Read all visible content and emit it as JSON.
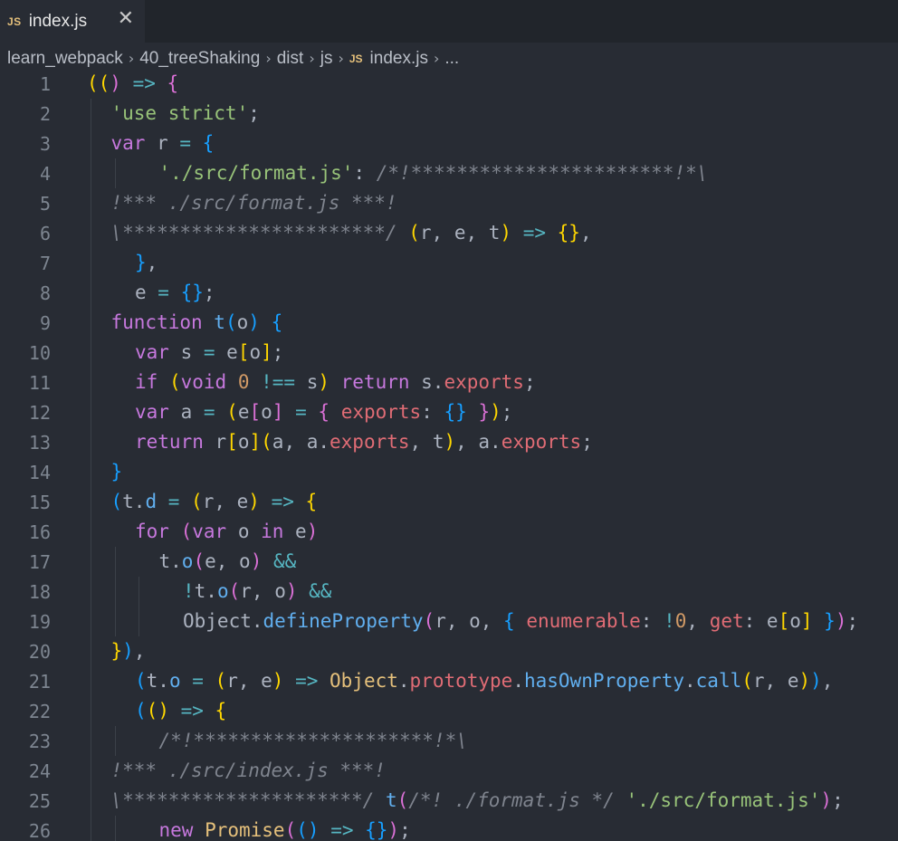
{
  "tab": {
    "badge": "JS",
    "label": "index.js",
    "close": "✕"
  },
  "breadcrumb": {
    "items": [
      "learn_webpack",
      "40_treeShaking",
      "dist",
      "js"
    ],
    "file_badge": "JS",
    "file": "index.js",
    "ellipsis": "..."
  },
  "editor": {
    "lines": [
      {
        "n": "1",
        "indent": 0,
        "guides": 0,
        "toks": [
          [
            "b1",
            "(("
          ],
          [
            "b2",
            ")"
          ],
          [
            "op",
            " => "
          ],
          [
            "b2",
            "{"
          ]
        ]
      },
      {
        "n": "2",
        "indent": 1,
        "guides": 1,
        "toks": [
          [
            "str",
            "'use strict'"
          ],
          [
            "tx",
            ";"
          ]
        ]
      },
      {
        "n": "3",
        "indent": 1,
        "guides": 1,
        "toks": [
          [
            "kw",
            "var "
          ],
          [
            "tx",
            "r "
          ],
          [
            "op",
            "= "
          ],
          [
            "b3",
            "{"
          ]
        ]
      },
      {
        "n": "4",
        "indent": 3,
        "guides": 2,
        "toks": [
          [
            "str",
            "'./src/format.js'"
          ],
          [
            "tx",
            ": "
          ],
          [
            "cm",
            "/*!***********************!*\\"
          ]
        ]
      },
      {
        "n": "5",
        "indent": 1,
        "guides": 1,
        "toks": [
          [
            "cm",
            "!*** ./src/format.js ***!"
          ]
        ]
      },
      {
        "n": "6",
        "indent": 1,
        "guides": 1,
        "toks": [
          [
            "cm",
            "\\***********************/ "
          ],
          [
            "b1",
            "("
          ],
          [
            "tx",
            "r, e, t"
          ],
          [
            "b1",
            ")"
          ],
          [
            "op",
            " => "
          ],
          [
            "b1",
            "{}"
          ],
          [
            "tx",
            ","
          ]
        ]
      },
      {
        "n": "7",
        "indent": 2,
        "guides": 1,
        "toks": [
          [
            "b3",
            "}"
          ],
          [
            "tx",
            ","
          ]
        ]
      },
      {
        "n": "8",
        "indent": 2,
        "guides": 1,
        "toks": [
          [
            "tx",
            "e "
          ],
          [
            "op",
            "= "
          ],
          [
            "b3",
            "{}"
          ],
          [
            "tx",
            ";"
          ]
        ]
      },
      {
        "n": "9",
        "indent": 1,
        "guides": 1,
        "toks": [
          [
            "kw",
            "function "
          ],
          [
            "fn",
            "t"
          ],
          [
            "b3",
            "("
          ],
          [
            "tx",
            "o"
          ],
          [
            "b3",
            ")"
          ],
          [
            "tx",
            " "
          ],
          [
            "b3",
            "{"
          ]
        ]
      },
      {
        "n": "10",
        "indent": 2,
        "guides": 1,
        "toks": [
          [
            "kw",
            "var "
          ],
          [
            "tx",
            "s "
          ],
          [
            "op",
            "= "
          ],
          [
            "tx",
            "e"
          ],
          [
            "b1",
            "["
          ],
          [
            "tx",
            "o"
          ],
          [
            "b1",
            "]"
          ],
          [
            "tx",
            ";"
          ]
        ]
      },
      {
        "n": "11",
        "indent": 2,
        "guides": 1,
        "toks": [
          [
            "kw",
            "if "
          ],
          [
            "b1",
            "("
          ],
          [
            "kw",
            "void "
          ],
          [
            "num",
            "0"
          ],
          [
            "op",
            " !== "
          ],
          [
            "tx",
            "s"
          ],
          [
            "b1",
            ")"
          ],
          [
            "kw",
            " return "
          ],
          [
            "tx",
            "s."
          ],
          [
            "prop",
            "exports"
          ],
          [
            "tx",
            ";"
          ]
        ]
      },
      {
        "n": "12",
        "indent": 2,
        "guides": 1,
        "toks": [
          [
            "kw",
            "var "
          ],
          [
            "tx",
            "a "
          ],
          [
            "op",
            "= "
          ],
          [
            "b1",
            "("
          ],
          [
            "tx",
            "e"
          ],
          [
            "b2",
            "["
          ],
          [
            "tx",
            "o"
          ],
          [
            "b2",
            "]"
          ],
          [
            "op",
            " = "
          ],
          [
            "b2",
            "{ "
          ],
          [
            "prop",
            "exports"
          ],
          [
            "tx",
            ": "
          ],
          [
            "b3",
            "{}"
          ],
          [
            "b2",
            " }"
          ],
          [
            "b1",
            ")"
          ],
          [
            "tx",
            ";"
          ]
        ]
      },
      {
        "n": "13",
        "indent": 2,
        "guides": 1,
        "toks": [
          [
            "kw",
            "return "
          ],
          [
            "tx",
            "r"
          ],
          [
            "b1",
            "["
          ],
          [
            "tx",
            "o"
          ],
          [
            "b1",
            "]"
          ],
          [
            "b1",
            "("
          ],
          [
            "tx",
            "a, a."
          ],
          [
            "prop",
            "exports"
          ],
          [
            "tx",
            ", t"
          ],
          [
            "b1",
            ")"
          ],
          [
            "tx",
            ", a."
          ],
          [
            "prop",
            "exports"
          ],
          [
            "tx",
            ";"
          ]
        ]
      },
      {
        "n": "14",
        "indent": 1,
        "guides": 1,
        "toks": [
          [
            "b3",
            "}"
          ]
        ]
      },
      {
        "n": "15",
        "indent": 1,
        "guides": 1,
        "toks": [
          [
            "b3",
            "("
          ],
          [
            "tx",
            "t."
          ],
          [
            "fn",
            "d"
          ],
          [
            "op",
            " = "
          ],
          [
            "b1",
            "("
          ],
          [
            "tx",
            "r, e"
          ],
          [
            "b1",
            ")"
          ],
          [
            "op",
            " => "
          ],
          [
            "b1",
            "{"
          ]
        ]
      },
      {
        "n": "16",
        "indent": 2,
        "guides": 1,
        "toks": [
          [
            "kw",
            "for "
          ],
          [
            "b2",
            "("
          ],
          [
            "kw",
            "var "
          ],
          [
            "tx",
            "o "
          ],
          [
            "kw",
            "in "
          ],
          [
            "tx",
            "e"
          ],
          [
            "b2",
            ")"
          ]
        ]
      },
      {
        "n": "17",
        "indent": 3,
        "guides": 2,
        "toks": [
          [
            "tx",
            "t."
          ],
          [
            "fn",
            "o"
          ],
          [
            "b2",
            "("
          ],
          [
            "tx",
            "e, o"
          ],
          [
            "b2",
            ")"
          ],
          [
            "op",
            " &&"
          ]
        ]
      },
      {
        "n": "18",
        "indent": 4,
        "guides": 3,
        "toks": [
          [
            "op",
            "!"
          ],
          [
            "tx",
            "t."
          ],
          [
            "fn",
            "o"
          ],
          [
            "b2",
            "("
          ],
          [
            "tx",
            "r, o"
          ],
          [
            "b2",
            ")"
          ],
          [
            "op",
            " &&"
          ]
        ]
      },
      {
        "n": "19",
        "indent": 4,
        "guides": 3,
        "toks": [
          [
            "tx",
            "Object."
          ],
          [
            "fn",
            "defineProperty"
          ],
          [
            "b2",
            "("
          ],
          [
            "tx",
            "r, o, "
          ],
          [
            "b3",
            "{ "
          ],
          [
            "prop",
            "enumerable"
          ],
          [
            "tx",
            ": "
          ],
          [
            "op",
            "!"
          ],
          [
            "num",
            "0"
          ],
          [
            "tx",
            ", "
          ],
          [
            "prop",
            "get"
          ],
          [
            "tx",
            ": e"
          ],
          [
            "b1",
            "["
          ],
          [
            "tx",
            "o"
          ],
          [
            "b1",
            "]"
          ],
          [
            "b3",
            " }"
          ],
          [
            "b2",
            ")"
          ],
          [
            "tx",
            ";"
          ]
        ]
      },
      {
        "n": "20",
        "indent": 1,
        "guides": 1,
        "toks": [
          [
            "b1",
            "}"
          ],
          [
            "b3",
            ")"
          ],
          [
            "tx",
            ","
          ]
        ]
      },
      {
        "n": "21",
        "indent": 2,
        "guides": 1,
        "toks": [
          [
            "b3",
            "("
          ],
          [
            "tx",
            "t."
          ],
          [
            "fn",
            "o"
          ],
          [
            "op",
            " = "
          ],
          [
            "b1",
            "("
          ],
          [
            "tx",
            "r, e"
          ],
          [
            "b1",
            ")"
          ],
          [
            "op",
            " => "
          ],
          [
            "cls",
            "Object"
          ],
          [
            "tx",
            "."
          ],
          [
            "prop",
            "prototype"
          ],
          [
            "tx",
            "."
          ],
          [
            "fn",
            "hasOwnProperty"
          ],
          [
            "tx",
            "."
          ],
          [
            "fn",
            "call"
          ],
          [
            "b1",
            "("
          ],
          [
            "tx",
            "r, e"
          ],
          [
            "b1",
            ")"
          ],
          [
            "b3",
            ")"
          ],
          [
            "tx",
            ","
          ]
        ]
      },
      {
        "n": "22",
        "indent": 2,
        "guides": 1,
        "toks": [
          [
            "b3",
            "("
          ],
          [
            "b1",
            "("
          ],
          [
            "b1",
            ")"
          ],
          [
            "op",
            " => "
          ],
          [
            "b1",
            "{"
          ]
        ]
      },
      {
        "n": "23",
        "indent": 3,
        "guides": 2,
        "toks": [
          [
            "cm",
            "/*!*********************!*\\"
          ]
        ]
      },
      {
        "n": "24",
        "indent": 1,
        "guides": 1,
        "toks": [
          [
            "cm",
            "!*** ./src/index.js ***!"
          ]
        ]
      },
      {
        "n": "25",
        "indent": 1,
        "guides": 1,
        "toks": [
          [
            "cm",
            "\\*********************/ "
          ],
          [
            "fn",
            "t"
          ],
          [
            "b2",
            "("
          ],
          [
            "cm",
            "/*! ./format.js */ "
          ],
          [
            "str",
            "'./src/format.js'"
          ],
          [
            "b2",
            ")"
          ],
          [
            "tx",
            ";"
          ]
        ]
      },
      {
        "n": "26",
        "indent": 3,
        "guides": 2,
        "toks": [
          [
            "kw",
            "new "
          ],
          [
            "cls",
            "Promise"
          ],
          [
            "b2",
            "("
          ],
          [
            "b3",
            "()"
          ],
          [
            "op",
            " => "
          ],
          [
            "b3",
            "{}"
          ],
          [
            "b2",
            ")"
          ],
          [
            "tx",
            ";"
          ]
        ]
      }
    ]
  },
  "colors": {
    "background": "#282c34",
    "tabbar": "#21252b",
    "keyword": "#c678dd",
    "function": "#61afef",
    "string": "#98c379",
    "comment": "#7f848e",
    "number": "#d19a66",
    "property": "#e06c75"
  }
}
